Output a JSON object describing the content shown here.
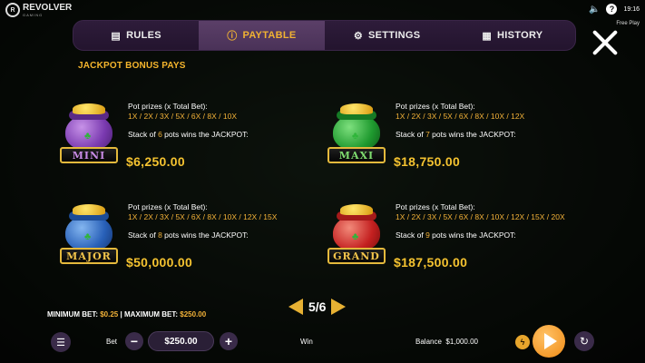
{
  "brand": {
    "name": "REVOLVER",
    "sub": "GAMING"
  },
  "status": {
    "time": "19:16",
    "free_play": "Free Play"
  },
  "tabs": [
    {
      "label": "RULES",
      "icon": "document-icon"
    },
    {
      "label": "PAYTABLE",
      "icon": "info-icon",
      "active": true
    },
    {
      "label": "SETTINGS",
      "icon": "gear-icon"
    },
    {
      "label": "HISTORY",
      "icon": "calendar-icon"
    }
  ],
  "section_title": "JACKPOT BONUS PAYS",
  "jackpots": [
    {
      "badge": "MINI",
      "pot_label": "Pot prizes (x Total Bet):",
      "multipliers": "1X / 2X / 3X / 5X / 6X / 8X / 10X",
      "stack_prefix": "Stack of ",
      "stack_count": "6",
      "stack_suffix": " pots wins the JACKPOT:",
      "amount": "$6,250.00",
      "color": "#8a44c2"
    },
    {
      "badge": "MAXI",
      "pot_label": "Pot prizes (x Total Bet):",
      "multipliers": "1X / 2X / 3X / 5X / 6X / 8X / 10X / 12X",
      "stack_prefix": "Stack of ",
      "stack_count": "7",
      "stack_suffix": " pots wins the JACKPOT:",
      "amount": "$18,750.00",
      "color": "#1f9a2f"
    },
    {
      "badge": "MAJOR",
      "pot_label": "Pot prizes (x Total Bet):",
      "multipliers": "1X / 2X / 3X / 5X / 6X / 8X / 10X / 12X / 15X",
      "stack_prefix": "Stack of ",
      "stack_count": "8",
      "stack_suffix": " pots wins the JACKPOT:",
      "amount": "$50,000.00",
      "color": "#2860b8"
    },
    {
      "badge": "GRAND",
      "pot_label": "Pot prizes (x Total Bet):",
      "multipliers": "1X / 2X / 3X / 5X / 6X / 8X / 10X / 12X / 15X / 20X",
      "stack_prefix": "Stack of ",
      "stack_count": "9",
      "stack_suffix": " pots wins the JACKPOT:",
      "amount": "$187,500.00",
      "color": "#c42020"
    }
  ],
  "pager": {
    "indicator": "5/6"
  },
  "limits": {
    "min_label": "MINIMUM BET: ",
    "min_value": "$0.25",
    "separator": " | ",
    "max_label": "MAXIMUM BET: ",
    "max_value": "$250.00"
  },
  "bottom": {
    "bet_label": "Bet",
    "bet_value": "$250.00",
    "win_label": "Win",
    "balance_label": "Balance",
    "balance_value": "$1,000.00"
  }
}
